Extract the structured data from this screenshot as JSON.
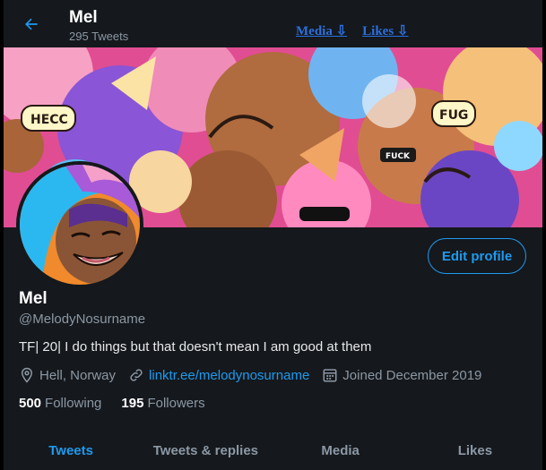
{
  "header": {
    "title": "Mel",
    "tweet_count": "295 Tweets",
    "links": [
      "Media ⇩",
      "Likes ⇩"
    ]
  },
  "profile": {
    "name": "Mel",
    "handle": "@MelodyNosurname",
    "bio": "TF| 20| I do things but that doesn't mean I am good at them",
    "location": "Hell, Norway",
    "website": "linktr.ee/melodynosurname",
    "joined": "Joined December 2019",
    "edit_label": "Edit profile"
  },
  "stats": {
    "following_count": "500",
    "following_label": "Following",
    "followers_count": "195",
    "followers_label": "Followers"
  },
  "tabs": [
    {
      "label": "Tweets"
    },
    {
      "label": "Tweets & replies"
    },
    {
      "label": "Media"
    },
    {
      "label": "Likes"
    }
  ],
  "banner_lettering": [
    "HECC",
    "FUG",
    "FUCK"
  ],
  "icons": {
    "back": "arrow-left-icon",
    "location": "map-pin-icon",
    "link": "link-icon",
    "calendar": "calendar-icon"
  },
  "colors": {
    "background": "#15181c",
    "accent": "#1d9bf0",
    "muted": "#8b98a5",
    "text": "#e7e9ea"
  }
}
